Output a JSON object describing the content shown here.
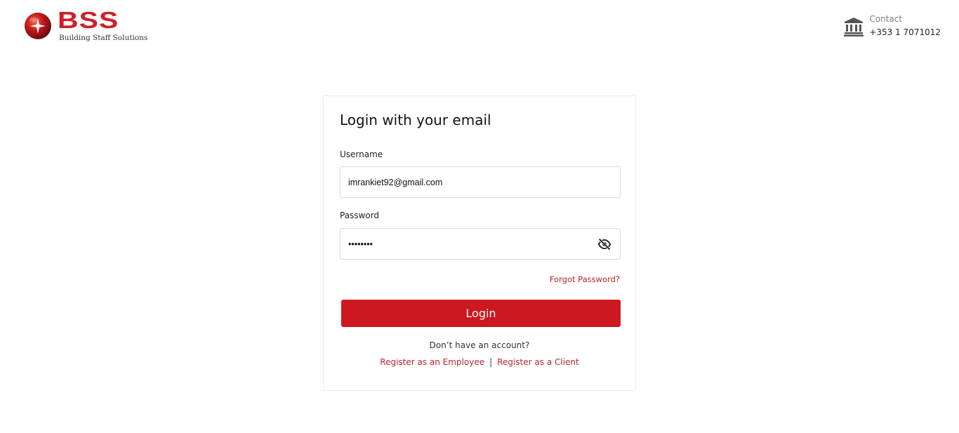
{
  "brand": {
    "logo_text": "BSS",
    "tagline": "Building Staff Solutions",
    "accent_color": "#cd1820"
  },
  "contact": {
    "icon": "bank-icon",
    "label": "Contact",
    "phone": "+353 1 7071012"
  },
  "login": {
    "title": "Login with your email",
    "username_label": "Username",
    "username_value": "imrankiet92@gmail.com",
    "password_label": "Password",
    "password_value": "12345678",
    "password_toggle_icon": "eye-slash-icon",
    "forgot_password": "Forgot Password?",
    "submit_label": "Login",
    "no_account_text": "Don’t have an account?",
    "register_employee": "Register as an Employee",
    "separator": "|",
    "register_client": "Register as a Client"
  }
}
